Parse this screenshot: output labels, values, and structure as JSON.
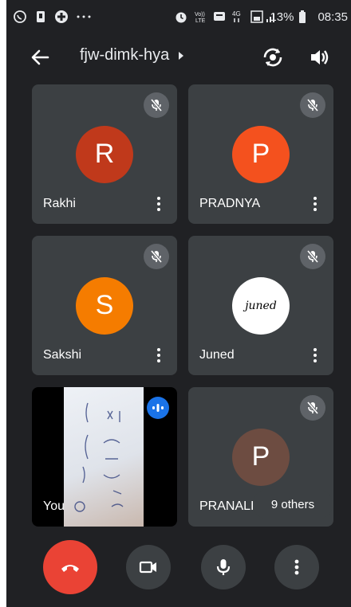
{
  "status_bar": {
    "battery_percent": "13%",
    "time": "08:35",
    "network": "4G",
    "volte": "Vo))\nLTE"
  },
  "app_bar": {
    "meeting_code": "fjw-dimk-hya"
  },
  "participants": [
    {
      "name": "Rakhi",
      "initial": "R",
      "color": "#c0391b",
      "muted": true
    },
    {
      "name": "PRADNYA",
      "initial": "P",
      "color": "#f4511e",
      "muted": true
    },
    {
      "name": "Sakshi",
      "initial": "S",
      "color": "#f57c00",
      "muted": true
    },
    {
      "name": "Juned",
      "initial": "juned",
      "color": "#ffffff",
      "muted": true
    },
    {
      "name": "You",
      "initial": "",
      "color": "#000000",
      "muted": false
    },
    {
      "name": "PRANALI",
      "initial": "P",
      "color": "#6d4c41",
      "muted": true
    }
  ],
  "others_chip": {
    "label": "9 others"
  },
  "controls": {
    "end_call_color": "#ea4335",
    "button_color": "#3c4043"
  }
}
